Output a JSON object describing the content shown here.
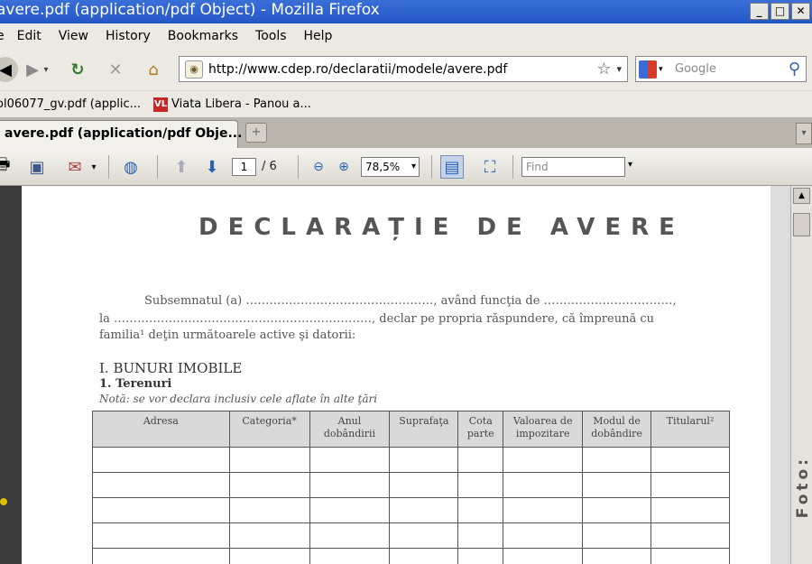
{
  "window": {
    "title": "avere.pdf (application/pdf Object) - Mozilla Firefox",
    "buttons": [
      "_",
      "□",
      "✕"
    ]
  },
  "menu": [
    "e",
    "Edit",
    "View",
    "History",
    "Bookmarks",
    "Tools",
    "Help"
  ],
  "nav": {
    "url": "http://www.cdep.ro/declaratii/modele/avere.pdf",
    "search_placeholder": "Google"
  },
  "bookmarks": [
    {
      "label": "ol06077_gv.pdf (applic..."
    },
    {
      "label": "Viata Libera - Panou a...",
      "favicon": "VL"
    }
  ],
  "tab": {
    "label": "avere.pdf (application/pdf Obje...",
    "new_tab": "+"
  },
  "pdf_toolbar": {
    "page": "1",
    "total": "/ 6",
    "zoom": "78,5%",
    "find_placeholder": "Find"
  },
  "document": {
    "title": "DECLARAȚIE DE AVERE",
    "line1": "Subsemnatul (a) …………………………………………, având funcţia de ……………………………,",
    "line2": "la …………………………………………………………, declar pe propria răspundere, că împreună cu",
    "line3": "familia¹ deţin următoarele active şi datorii:",
    "section": "I. BUNURI IMOBILE",
    "subsection": "1. Terenuri",
    "note": "Notă: se vor declara inclusiv cele aflate în alte ţări",
    "table": {
      "headers": [
        {
          "l1": "Adresa",
          "l2": ""
        },
        {
          "l1": "Categoria*",
          "l2": ""
        },
        {
          "l1": "Anul",
          "l2": "dobândirii"
        },
        {
          "l1": "Suprafaţa",
          "l2": ""
        },
        {
          "l1": "Cota",
          "l2": "parte"
        },
        {
          "l1": "Valoarea de",
          "l2": "impozitare"
        },
        {
          "l1": "Modul de",
          "l2": "dobândire"
        },
        {
          "l1": "Titularul²",
          "l2": ""
        }
      ],
      "empty_rows": 5
    }
  },
  "watermark": "Foto:",
  "colors": {
    "titlebar": "#2457c5",
    "chrome": "#ece9e2",
    "workspace": "#6b6b6b"
  }
}
